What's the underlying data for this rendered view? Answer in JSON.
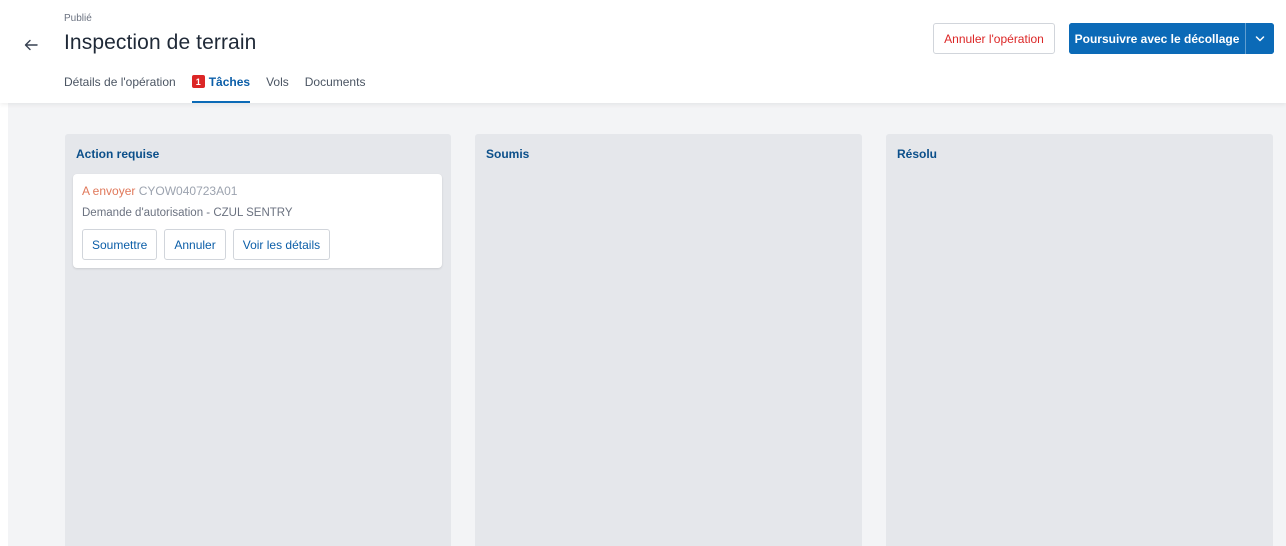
{
  "header": {
    "status": "Publié",
    "title": "Inspection de terrain",
    "cancel_operation_label": "Annuler l'opération",
    "primary_action_label": "Poursuivre avec le décollage"
  },
  "tabs": [
    {
      "label": "Détails de l'opération",
      "active": false
    },
    {
      "label": "Tâches",
      "active": true,
      "badge": "1"
    },
    {
      "label": "Vols",
      "active": false
    },
    {
      "label": "Documents",
      "active": false
    }
  ],
  "columns": [
    {
      "title": "Action requise",
      "cards": [
        {
          "status": "A envoyer",
          "reference": "CYOW040723A01",
          "description": "Demande d'autorisation - CZUL SENTRY",
          "actions": [
            "Soumettre",
            "Annuler",
            "Voir les détails"
          ]
        }
      ]
    },
    {
      "title": "Soumis",
      "cards": []
    },
    {
      "title": "Résolu",
      "cards": []
    }
  ],
  "colors": {
    "accent": "#0b6ab7",
    "danger": "#dc2626",
    "pending_status": "#e0785a",
    "column_bg": "#e5e7eb",
    "board_bg": "#f3f4f6"
  },
  "icons": {
    "back": "arrow-left-icon",
    "dropdown": "chevron-down-icon"
  }
}
